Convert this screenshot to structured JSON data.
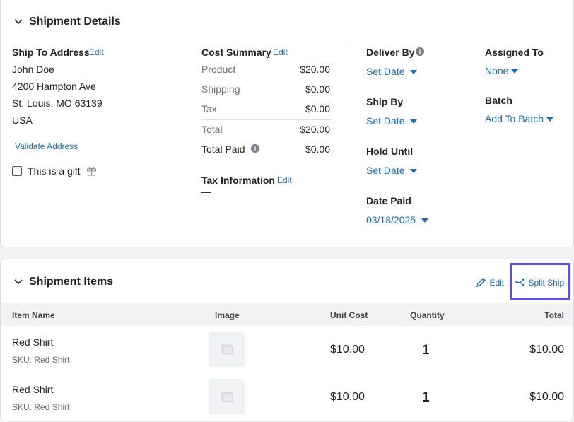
{
  "details": {
    "title": "Shipment Details",
    "ship_to": {
      "label": "Ship To Address",
      "edit": "Edit",
      "lines": [
        "John Doe",
        "4200 Hampton Ave",
        "St. Louis, MO 63139",
        "USA"
      ],
      "validate": "Validate Address",
      "gift_label": "This is a gift"
    },
    "cost": {
      "label": "Cost Summary",
      "edit": "Edit",
      "rows": [
        {
          "name": "Product",
          "value": "$20.00"
        },
        {
          "name": "Shipping",
          "value": "$0.00"
        },
        {
          "name": "Tax",
          "value": "$0.00"
        },
        {
          "name": "Total",
          "value": "$20.00"
        },
        {
          "name": "Total Paid",
          "value": "$0.00"
        }
      ]
    },
    "tax": {
      "label": "Tax Information",
      "edit": "Edit",
      "value": "—"
    },
    "deliver_by": {
      "label": "Deliver By",
      "value": "Set Date"
    },
    "ship_by": {
      "label": "Ship By",
      "value": "Set Date"
    },
    "hold_until": {
      "label": "Hold Until",
      "value": "Set Date"
    },
    "date_paid": {
      "label": "Date Paid",
      "value": "03/18/2025"
    },
    "assigned_to": {
      "label": "Assigned To",
      "value": "None"
    },
    "batch": {
      "label": "Batch",
      "value": "Add To Batch"
    }
  },
  "items": {
    "title": "Shipment Items",
    "edit": "Edit",
    "split": "Split Ship",
    "columns": [
      "Item Name",
      "Image",
      "Unit Cost",
      "Quantity",
      "Total"
    ],
    "rows": [
      {
        "name": "Red Shirt",
        "sku": "SKU: Red Shirt",
        "unit_cost": "$10.00",
        "qty": "1",
        "total": "$10.00"
      },
      {
        "name": "Red Shirt",
        "sku": "SKU: Red Shirt",
        "unit_cost": "$10.00",
        "qty": "1",
        "total": "$10.00"
      }
    ]
  },
  "colors": {
    "link": "#1a6fb0",
    "highlight": "#5b4de8"
  }
}
